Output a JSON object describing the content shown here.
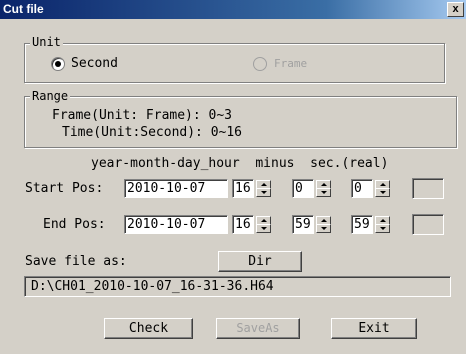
{
  "window": {
    "title": "Cut file",
    "close_label": "x"
  },
  "unit": {
    "legend": "Unit",
    "second_label": "Second",
    "frame_label": "Frame",
    "selected": "Second"
  },
  "range": {
    "legend": "Range",
    "frame_line": "Frame(Unit: Frame): 0~3",
    "time_line": "Time(Unit:Second): 0~16"
  },
  "time_header": "year-month-day_hour  minus  sec.(real)",
  "start": {
    "label": "Start Pos:",
    "date": "2010-10-07",
    "hour": "16",
    "minute": "0",
    "second": "0"
  },
  "end": {
    "label": "End Pos:",
    "date": "2010-10-07",
    "hour": "16",
    "minute": "59",
    "second": "59"
  },
  "save": {
    "label": "Save file as:",
    "dir_button": "Dir",
    "path": "D:\\CH01_2010-10-07_16-31-36.H64"
  },
  "buttons": {
    "check": "Check",
    "saveas": "SaveAs",
    "exit": "Exit"
  }
}
